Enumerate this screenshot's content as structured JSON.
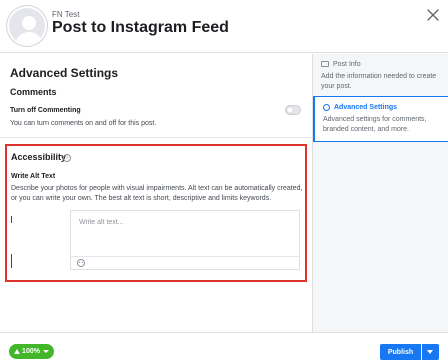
{
  "header": {
    "account_name": "FN Test",
    "title": "Post to Instagram Feed",
    "close_icon": "close-icon"
  },
  "main": {
    "section_title": "Advanced Settings",
    "comments": {
      "heading": "Comments",
      "toggle_label": "Turn off Commenting",
      "toggle_on": false,
      "description": "You can turn comments on and off for this post."
    },
    "accessibility": {
      "heading": "Accessibility",
      "info_icon": "info-icon",
      "alt_label": "Write Alt Text",
      "alt_description": "Describe your photos for people with visual impairments. Alt text can be automatically created, or you can write your own. The best alt text is short, descriptive and limits keywords.",
      "alt_placeholder": "Write alt text...",
      "emoji_icon": "emoji-icon",
      "highlight_color": "#e0322c"
    }
  },
  "sidebar": {
    "steps": [
      {
        "title": "Post Info",
        "description": "Add the information needed to create your post.",
        "icon": "post-info-icon",
        "active": false
      },
      {
        "title": "Advanced Settings",
        "description": "Advanced settings for comments, branded content, and more.",
        "icon": "gear-icon",
        "active": true
      }
    ]
  },
  "footer": {
    "zoom_label": "100%",
    "publish_label": "Publish",
    "accent_color": "#1877f2",
    "zoom_color": "#42b72a"
  }
}
